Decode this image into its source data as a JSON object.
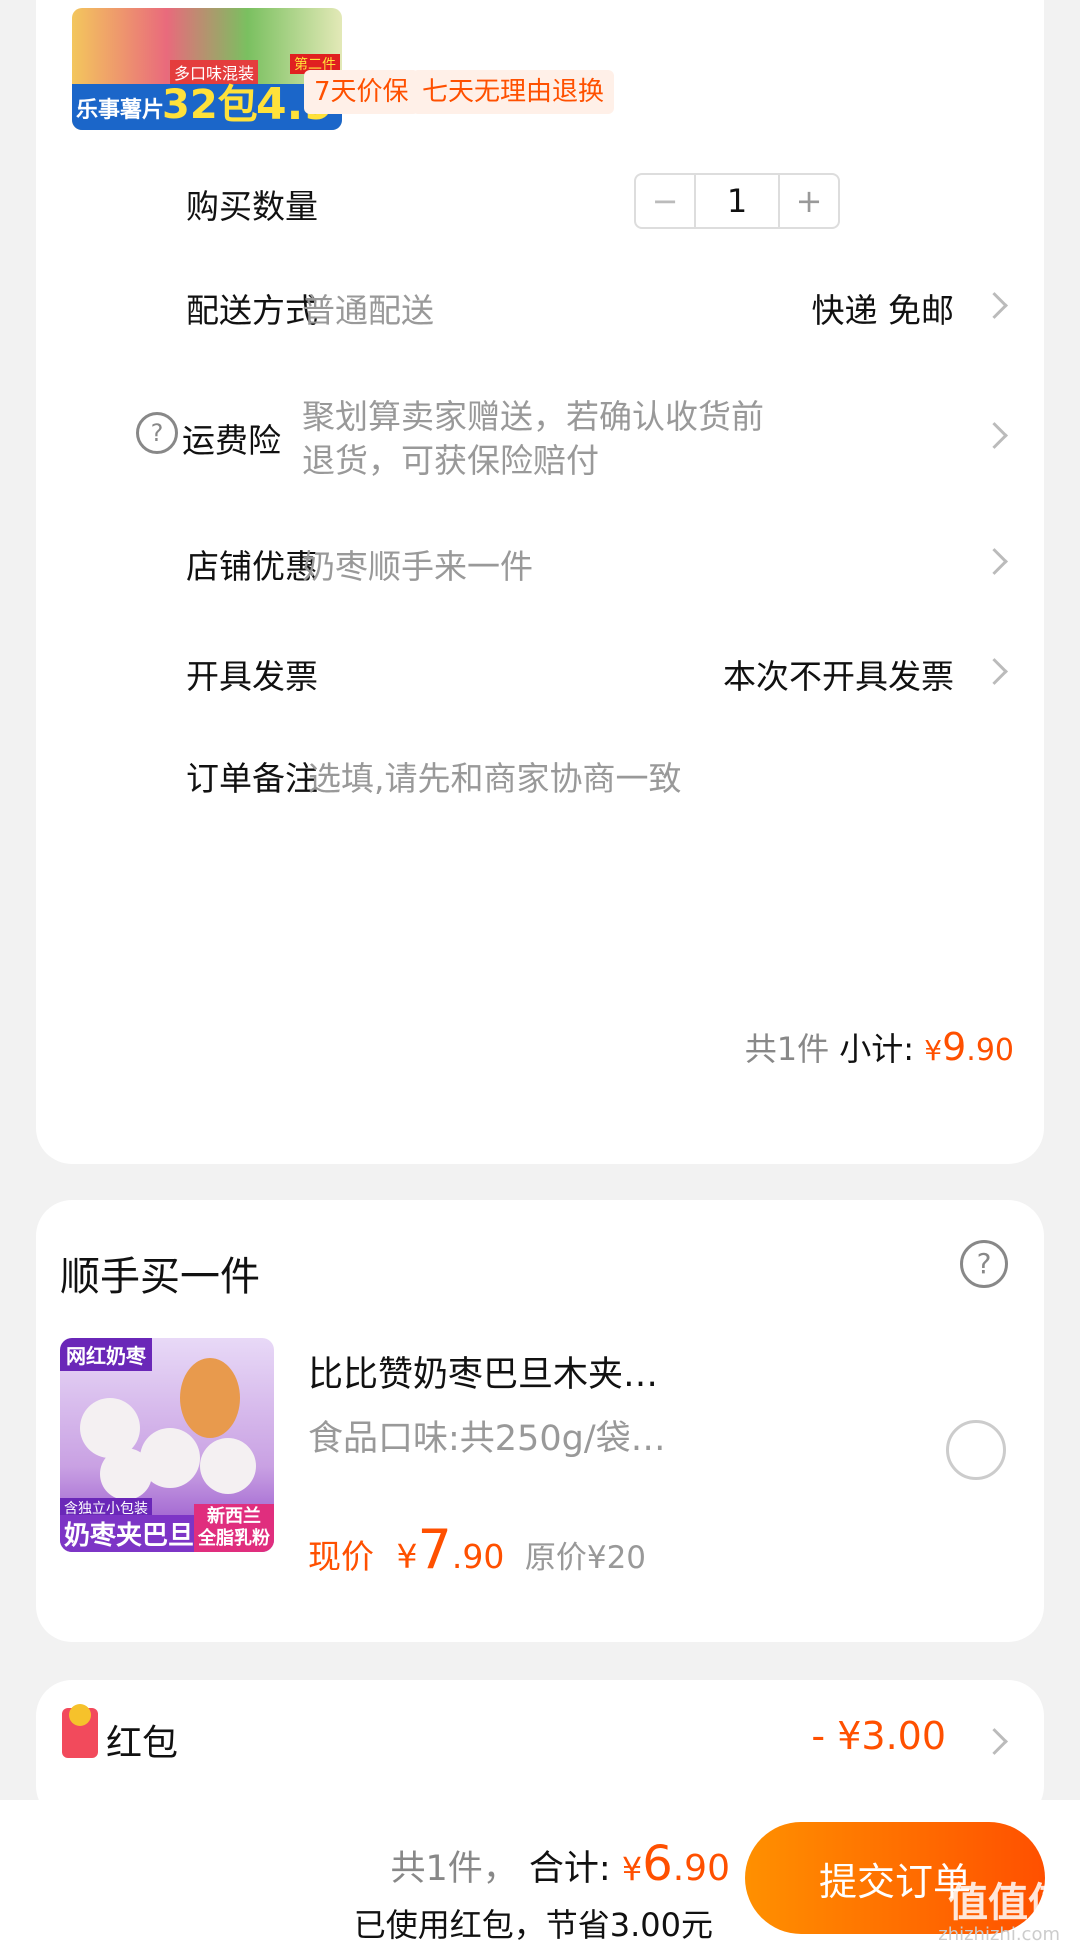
{
  "product": {
    "image": {
      "line1": "乐事薯片",
      "count": "32包",
      "price": "4.9",
      "mix": "多口味混装",
      "badge": "第二件"
    },
    "tags": [
      "7天价保",
      "七天无理由退换"
    ]
  },
  "order_rows": {
    "quantity": {
      "label": "购买数量",
      "value": "1",
      "minus": "−",
      "plus": "+"
    },
    "delivery": {
      "label": "配送方式",
      "hint": "普通配送",
      "value": "快递 免邮"
    },
    "insurance": {
      "label": "运费险",
      "hint_line1": "聚划算卖家赠送，若确认收货前",
      "hint_line2": "退货，可获保险赔付"
    },
    "shop_discount": {
      "label": "店铺优惠",
      "hint": "奶枣顺手来一件"
    },
    "invoice": {
      "label": "开具发票",
      "value": "本次不开具发票"
    },
    "note": {
      "label": "订单备注",
      "placeholder": "选填,请先和商家协商一致"
    }
  },
  "subtotal": {
    "count": "共1件",
    "label": "小计:",
    "currency": "¥",
    "int": "9",
    "dec": ".90"
  },
  "addon": {
    "title": "顺手买一件",
    "image": {
      "tag": "网红奶枣",
      "small": "含独立小包装",
      "main": "奶枣夹巴旦木",
      "badge1": "新西兰",
      "badge2": "全脂乳粉"
    },
    "name": "比比赞奶枣巴旦木夹…",
    "spec": "食品口味:共250g/袋…",
    "price_label": "现价",
    "currency": "¥",
    "price_int": "7",
    "price_dec": ".90",
    "original": "原价¥20"
  },
  "redpacket": {
    "label": "红包",
    "value": "- ¥3.00"
  },
  "footer": {
    "count": "共1件，",
    "total_label": "合计:",
    "currency": "¥",
    "total_int": "6",
    "total_dec": ".90",
    "saved": "已使用红包，节省3.00元",
    "submit": "提交订单",
    "watermark": "值值值",
    "watermark_url": "zhizhizhi.com"
  },
  "colors": {
    "accent": "#ff5000",
    "background": "#f2f2f2"
  }
}
